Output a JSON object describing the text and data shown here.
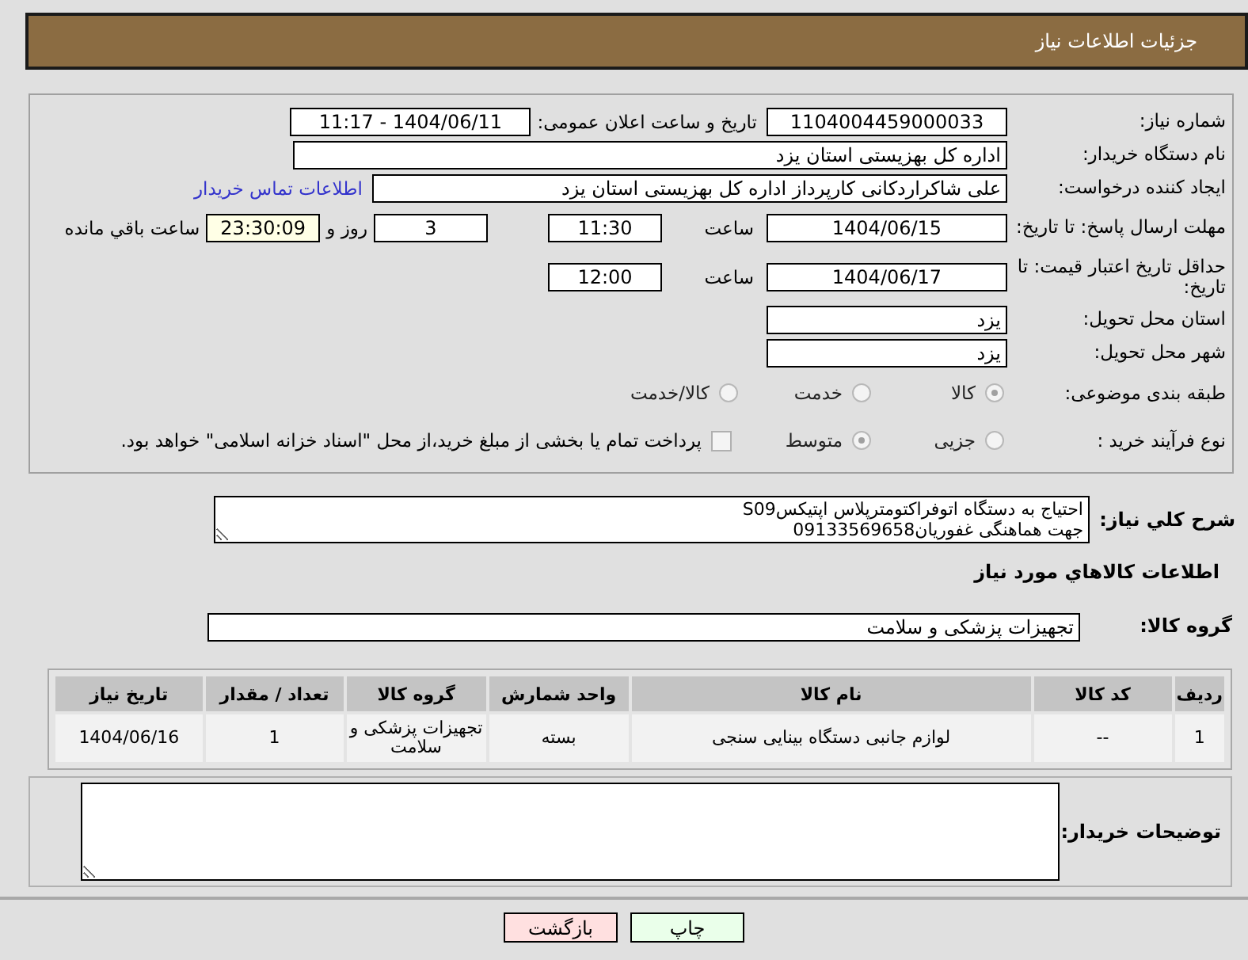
{
  "header": {
    "title": "جزئیات اطلاعات نیاز"
  },
  "need_number": {
    "label": "شماره نیاز:",
    "value": "1104004459000033"
  },
  "announce": {
    "label": "تاریخ و ساعت اعلان عمومی:",
    "value": "1404/06/11 - 11:17"
  },
  "buyer": {
    "label": "نام دستگاه خریدار:",
    "value": "اداره کل بهزیستی استان یزد"
  },
  "creator": {
    "label": "ایجاد کننده درخواست:",
    "value": "علی شاکراردکانی کارپرداز اداره کل بهزیستی استان یزد",
    "link": "اطلاعات تماس خریدار"
  },
  "reply_deadline": {
    "label": "مهلت ارسال پاسخ: تا تاریخ:",
    "date": "1404/06/15",
    "time_label": "ساعت",
    "time": "11:30",
    "days": "3",
    "days_label": "روز و",
    "remaining": "23:30:09",
    "remaining_label": "ساعت باقي مانده"
  },
  "price_validity": {
    "label": "حداقل تاریخ اعتبار قیمت: تا تاریخ:",
    "date": "1404/06/17",
    "time_label": "ساعت",
    "time": "12:00"
  },
  "province": {
    "label": "استان محل تحویل:",
    "value": "یزد"
  },
  "city": {
    "label": "شهر محل تحویل:",
    "value": "یزد"
  },
  "category": {
    "label": "طبقه بندی موضوعی:",
    "options": [
      {
        "label": "کالا",
        "selected": true
      },
      {
        "label": "خدمت",
        "selected": false
      },
      {
        "label": "کالا/خدمت",
        "selected": false
      }
    ]
  },
  "purchase_type": {
    "label": "نوع فرآیند خرید :",
    "options": [
      {
        "label": "جزیی",
        "selected": false
      },
      {
        "label": "متوسط",
        "selected": true
      }
    ],
    "treasury": {
      "checked": false,
      "text": "پرداخت تمام یا بخشی از مبلغ خرید،از محل \"اسناد خزانه اسلامی\" خواهد بود."
    }
  },
  "description": {
    "label": "شرح کلي نیاز:",
    "value": "احتیاج به دستگاه اتوفراکتومترپلاس اپتیکسS09\nجهت هماهنگی غفوریان09133569658"
  },
  "goods_title": "اطلاعات کالاهاي مورد نیاز",
  "goods_group": {
    "label": "گروه کالا:",
    "value": "تجهیزات پزشکی و سلامت"
  },
  "table": {
    "columns": [
      "ردیف",
      "کد کالا",
      "نام کالا",
      "واحد شمارش",
      "گروه کالا",
      "تعداد / مقدار",
      "تاریخ نیاز"
    ],
    "rows": [
      [
        "1",
        "--",
        "لوازم جانبی دستگاه بینایی سنجی",
        "بسته",
        "تجهیزات پزشکی و سلامت",
        "1",
        "1404/06/16"
      ]
    ]
  },
  "buyer_notes": {
    "label": "توضیحات خریدار:"
  },
  "buttons": [
    {
      "label": "چاپ",
      "kind": "print"
    },
    {
      "label": "بازگشت",
      "kind": "back"
    }
  ]
}
